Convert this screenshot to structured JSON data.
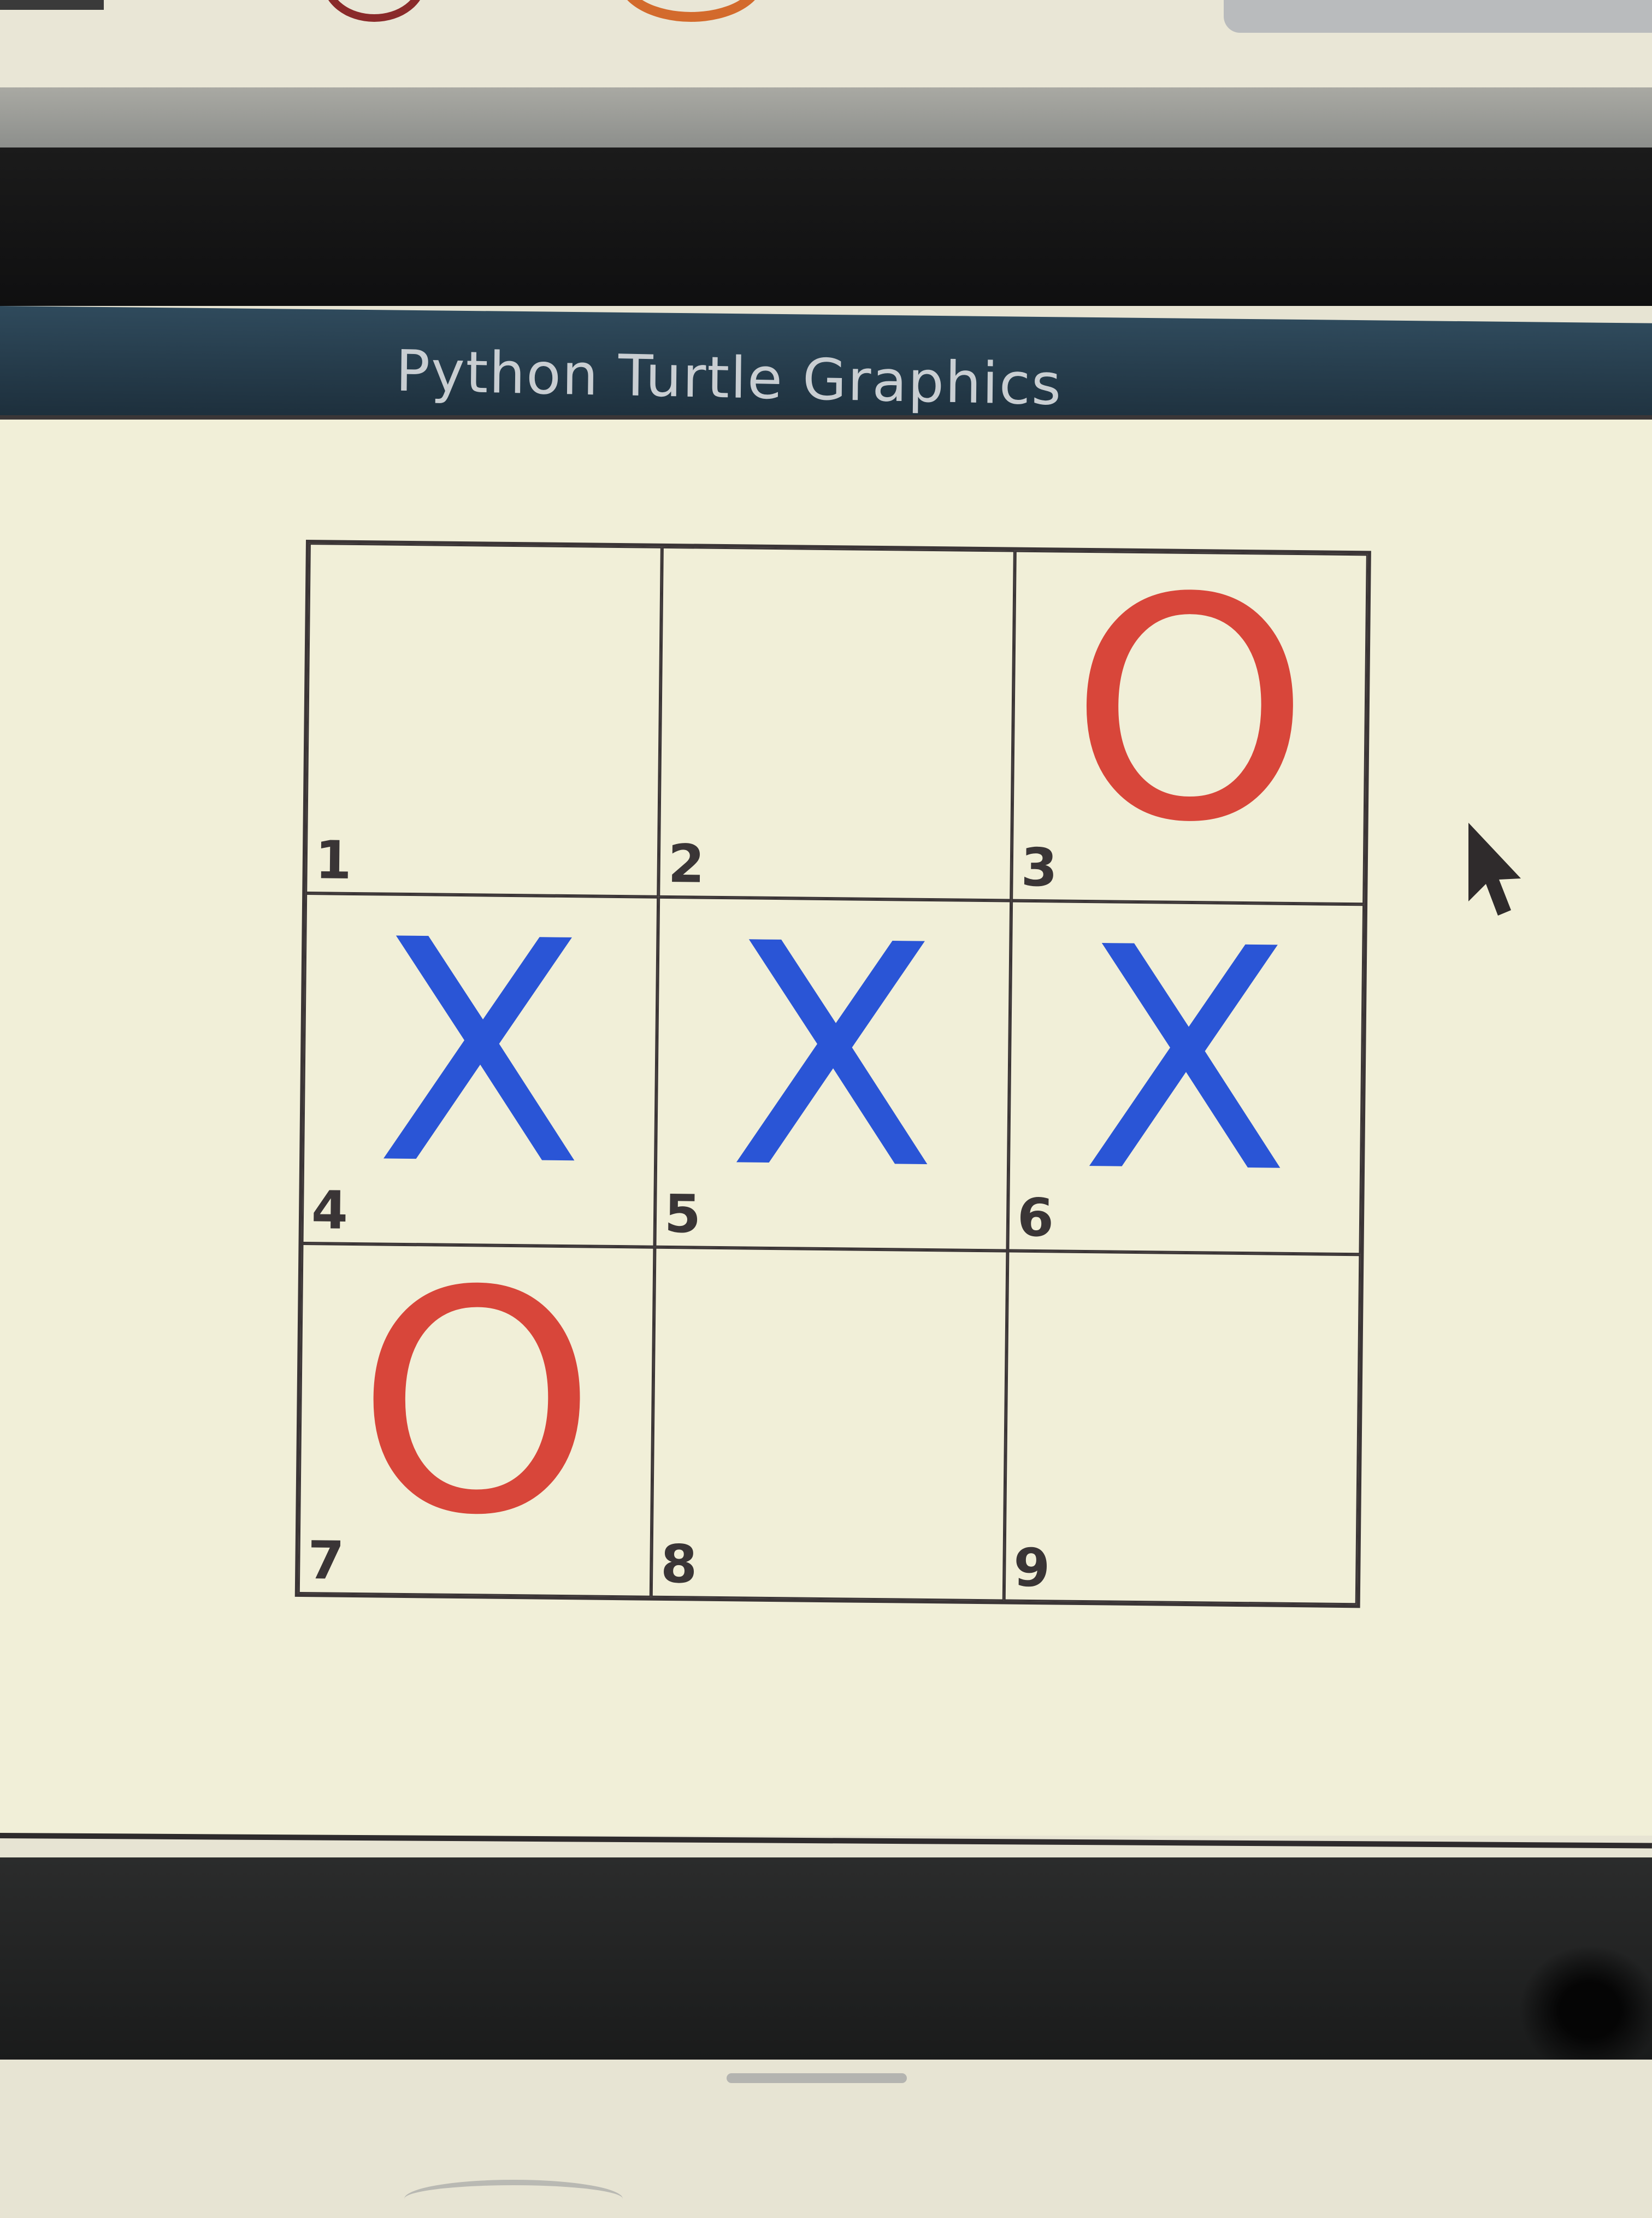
{
  "window": {
    "title": "Python Turtle Graphics"
  },
  "board": {
    "cells": [
      {
        "number": "1",
        "mark": ""
      },
      {
        "number": "2",
        "mark": ""
      },
      {
        "number": "3",
        "mark": "O"
      },
      {
        "number": "4",
        "mark": "X"
      },
      {
        "number": "5",
        "mark": "X"
      },
      {
        "number": "6",
        "mark": "X"
      },
      {
        "number": "7",
        "mark": "O"
      },
      {
        "number": "8",
        "mark": ""
      },
      {
        "number": "9",
        "mark": ""
      }
    ]
  },
  "colors": {
    "x_mark": "#2a55d6",
    "o_mark": "#d8463a",
    "canvas_background": "#f1efd8",
    "title_bar": "#2a4152",
    "grid_lines": "#3b3536"
  },
  "icons": {
    "pointer": "mouse-pointer-icon"
  }
}
